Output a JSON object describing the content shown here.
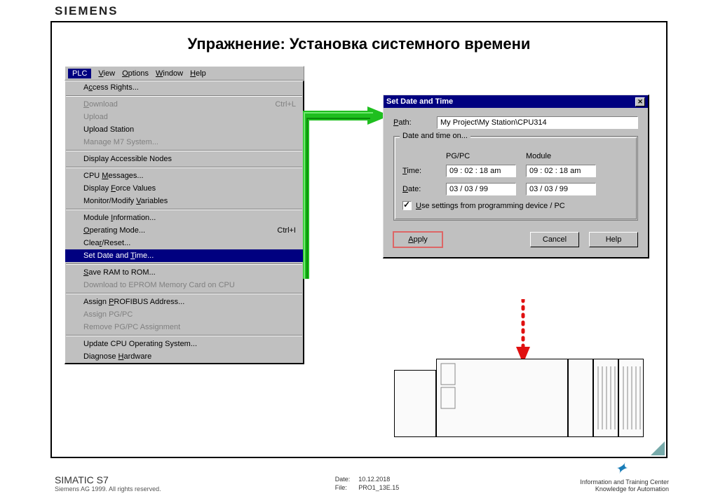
{
  "brand": "SIEMENS",
  "slide_title": "Упражнение: Установка системного времени",
  "menubar": {
    "plc": "PLC",
    "view": "View",
    "options": "Options",
    "window": "Window",
    "help": "Help"
  },
  "menu": {
    "access_rights": "Access Rights...",
    "download": "Download",
    "download_sc": "Ctrl+L",
    "upload": "Upload",
    "upload_station": "Upload Station",
    "manage_m7": "Manage M7 System...",
    "display_nodes": "Display Accessible Nodes",
    "cpu_msgs": "CPU Messages...",
    "force_values": "Display Force Values",
    "mon_mod": "Monitor/Modify Variables",
    "mod_info": "Module Information...",
    "op_mode": "Operating Mode...",
    "op_mode_sc": "Ctrl+I",
    "clear_reset": "Clear/Reset...",
    "set_datetime": "Set Date and Time...",
    "save_ram": "Save RAM to ROM...",
    "dl_eprom": "Download to EPROM Memory Card on CPU",
    "assign_profibus": "Assign PROFIBUS Address...",
    "assign_pgpc": "Assign PG/PC",
    "remove_pgpc": "Remove PG/PC Assignment",
    "update_cpu": "Update CPU Operating System...",
    "diag_hw": "Diagnose Hardware"
  },
  "dialog": {
    "title": "Set Date and Time",
    "path_label": "Path:",
    "path_value": "My Project\\My Station\\CPU314",
    "group_title": "Date and time on...",
    "col_pgpc": "PG/PC",
    "col_module": "Module",
    "time_label": "Time:",
    "time_pgpc": "09 : 02 : 18 am",
    "time_module": "09 : 02 : 18 am",
    "date_label": "Date:",
    "date_pgpc": "03 / 03 / 99",
    "date_module": "03 / 03 / 99",
    "use_settings": "Use settings from programming device / PC",
    "apply": "Apply",
    "cancel": "Cancel",
    "help": "Help"
  },
  "footer": {
    "product": "SIMATIC S7",
    "copyright": "Siemens AG 1999. All rights reserved.",
    "date_label": "Date:",
    "date_value": "10.12.2018",
    "file_label": "File:",
    "file_value": "PRO1_13E.15",
    "info1": "Information and Training Center",
    "info2": "Knowledge for Automation"
  }
}
